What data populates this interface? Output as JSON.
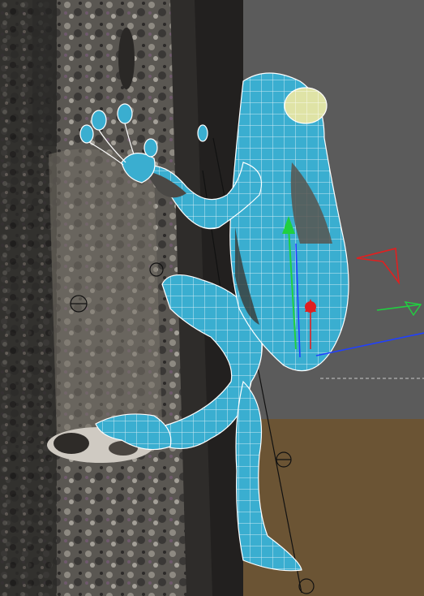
{
  "viewport": {
    "background_color": "#5b5b5b",
    "ground_color": "#6b5434",
    "bark_color": "#5e5a55",
    "mesh_color": "#3aaed0",
    "wireframe_color": "#ffffff"
  },
  "scene_objects": [
    {
      "name": "tree-trunk"
    },
    {
      "name": "branch-stub"
    },
    {
      "name": "frog-mesh"
    },
    {
      "name": "move-gizmo"
    },
    {
      "name": "world-axis-tripod"
    },
    {
      "name": "bone-helpers"
    }
  ],
  "gizmo": {
    "axis_x_color": "#e02020",
    "axis_y_color": "#20d040",
    "axis_z_color": "#2040ff"
  }
}
